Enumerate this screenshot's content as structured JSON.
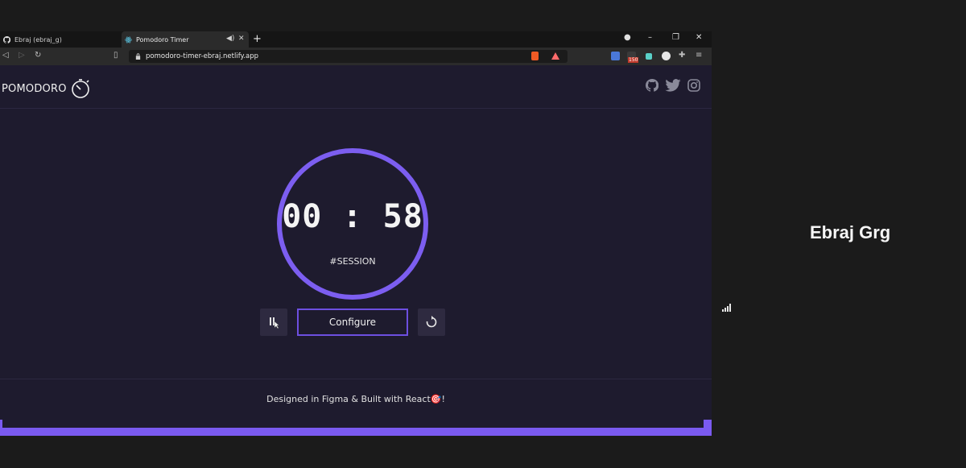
{
  "browser": {
    "tabs": [
      {
        "title": "Ebraj (ebraj_g)",
        "icon": "github-icon",
        "active": false
      },
      {
        "title": "Pomodoro Timer",
        "icon": "react-icon",
        "active": true
      }
    ],
    "url": "pomodoro-timer-ebraj.netlify.app",
    "extension_badge": "150"
  },
  "header": {
    "logo_text": "POMODORO",
    "social": [
      "github-icon",
      "twitter-icon",
      "instagram-icon"
    ]
  },
  "timer": {
    "time": "00 : 58",
    "label": "#SESSION",
    "ring_color": "#7c5ef0"
  },
  "controls": {
    "configure_label": "Configure"
  },
  "footer": {
    "text": "Designed in Figma & Built with React🎯!"
  },
  "presenter": {
    "name": "Ebraj Grg"
  },
  "colors": {
    "accent": "#7a5af0",
    "page_bg": "#1e1b2e"
  }
}
